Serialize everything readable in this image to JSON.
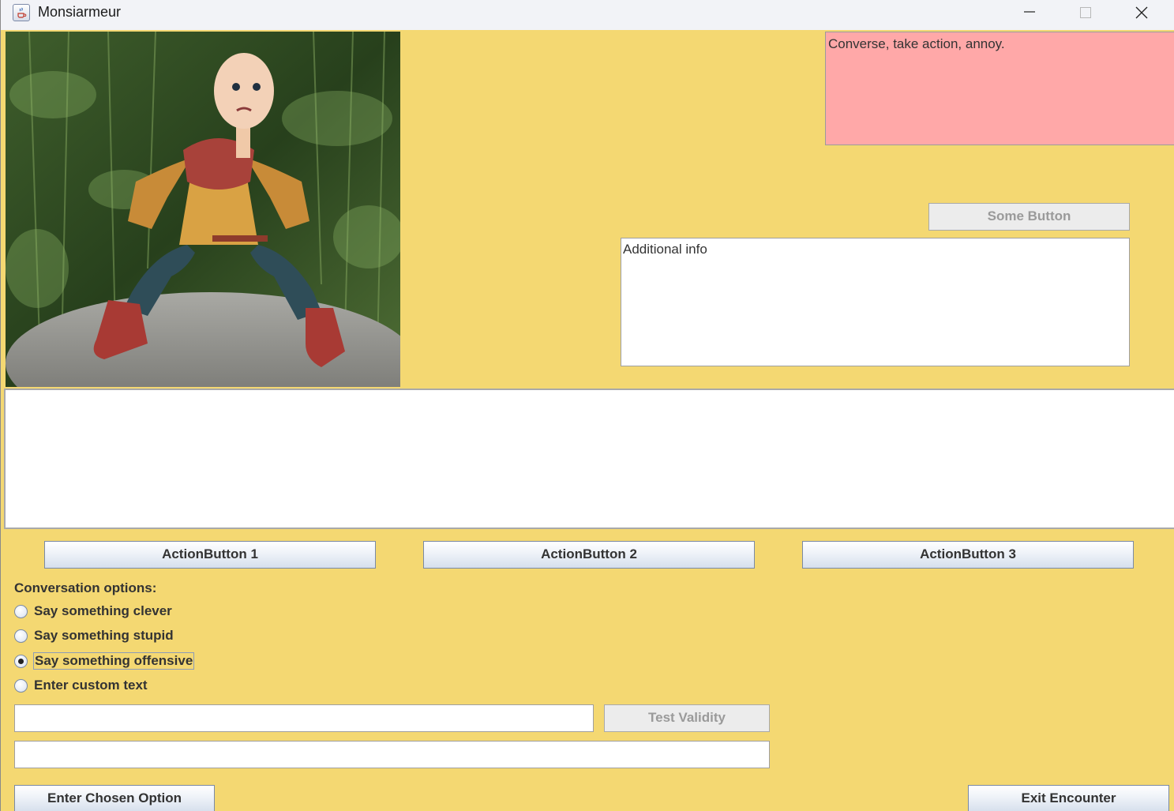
{
  "window": {
    "title": "Monsiarmeur",
    "background_color": "#f4d872"
  },
  "status": {
    "text": "Converse, take action, annoy.",
    "background_color": "#ffa8a8"
  },
  "some_button": {
    "label": "Some Button",
    "enabled": false
  },
  "info": {
    "text": "Additional info"
  },
  "log": {
    "text": ""
  },
  "action_buttons": [
    {
      "label": "ActionButton 1"
    },
    {
      "label": "ActionButton 2"
    },
    {
      "label": "ActionButton 3"
    }
  ],
  "conversation": {
    "label": "Conversation options:",
    "options": [
      {
        "label": "Say something clever",
        "selected": false
      },
      {
        "label": "Say something stupid",
        "selected": false
      },
      {
        "label": "Say something offensive",
        "selected": true
      },
      {
        "label": "Enter custom text",
        "selected": false
      }
    ],
    "custom_text_value": "",
    "result_value": ""
  },
  "test_validity": {
    "label": "Test Validity",
    "enabled": false
  },
  "enter_chosen": {
    "label": "Enter Chosen Option"
  },
  "exit_encounter": {
    "label": "Exit Encounter"
  },
  "icons": {
    "app": "java-coffee-icon",
    "minimize": "minimize-icon",
    "maximize": "maximize-icon",
    "close": "close-icon"
  }
}
